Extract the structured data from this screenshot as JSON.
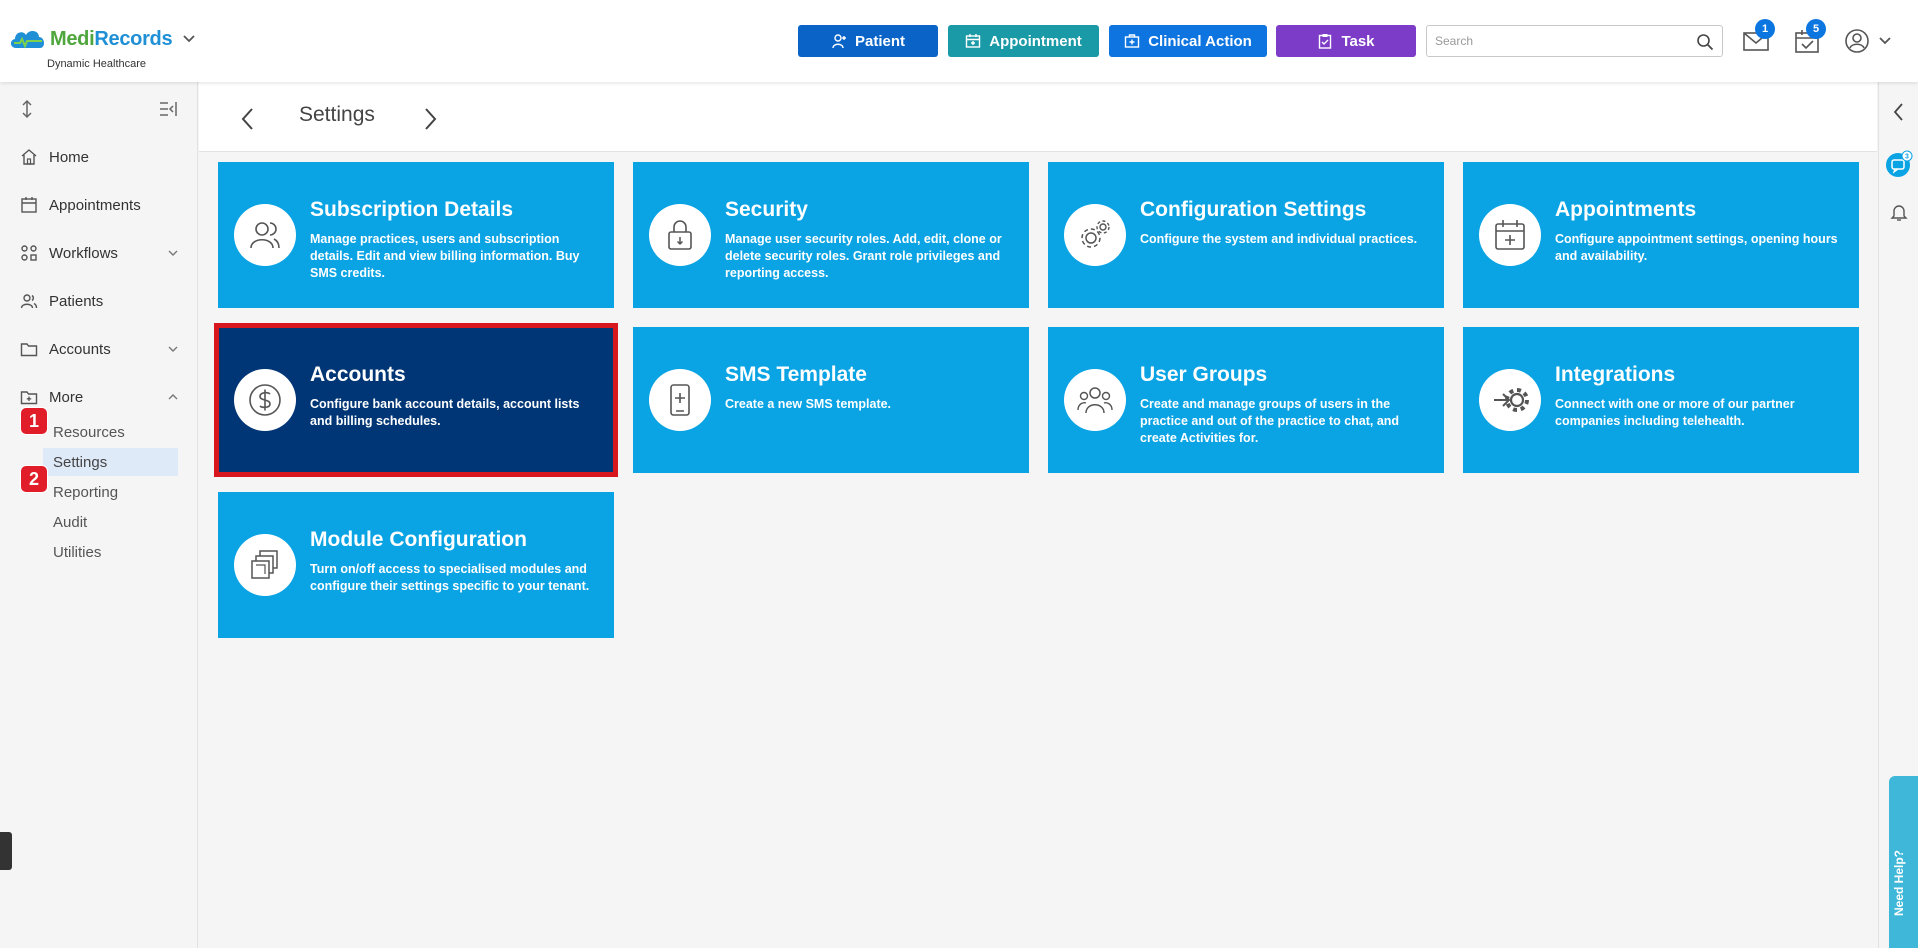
{
  "header": {
    "brand_medi": "Medi",
    "brand_records": "Records",
    "brand_subtitle": "Dynamic Healthcare",
    "buttons": {
      "patient": "Patient",
      "appointment": "Appointment",
      "clinical_action": "Clinical Action",
      "task": "Task"
    },
    "search_placeholder": "Search",
    "mail_badge": "1",
    "calendar_badge": "5"
  },
  "sidebar": {
    "items": [
      {
        "label": "Home"
      },
      {
        "label": "Appointments"
      },
      {
        "label": "Workflows"
      },
      {
        "label": "Patients"
      },
      {
        "label": "Accounts"
      },
      {
        "label": "More"
      }
    ],
    "more_subitems": [
      {
        "label": "Resources"
      },
      {
        "label": "Settings"
      },
      {
        "label": "Reporting"
      },
      {
        "label": "Audit"
      },
      {
        "label": "Utilities"
      }
    ],
    "active_subitem": "Settings",
    "step_markers": [
      "1",
      "2"
    ]
  },
  "page": {
    "title": "Settings"
  },
  "cards": [
    {
      "title": "Subscription Details",
      "desc": "Manage practices, users and subscription details. Edit and view billing information. Buy SMS credits.",
      "icon": "users-icon"
    },
    {
      "title": "Security",
      "desc": "Manage user security roles. Add, edit, clone or delete security roles. Grant role privileges and reporting access.",
      "icon": "lock-icon"
    },
    {
      "title": "Configuration Settings",
      "desc": "Configure the system and individual practices.",
      "icon": "gears-icon"
    },
    {
      "title": "Appointments",
      "desc": "Configure appointment settings, opening hours and availability.",
      "icon": "calendar-plus-icon"
    },
    {
      "title": "Accounts",
      "desc": "Configure bank account details, account lists and billing schedules.",
      "icon": "dollar-icon",
      "selected": true
    },
    {
      "title": "SMS Template",
      "desc": "Create a new SMS template.",
      "icon": "phone-plus-icon"
    },
    {
      "title": "User Groups",
      "desc": "Create and manage groups of users in the practice and out of the practice to chat, and create Activities for.",
      "icon": "user-group-icon"
    },
    {
      "title": "Integrations",
      "desc": "Connect with one or more of our partner companies including telehealth.",
      "icon": "integration-icon"
    },
    {
      "title": "Module Configuration",
      "desc": "Turn on/off access to specialised modules and configure their settings specific to your tenant.",
      "icon": "modules-icon"
    }
  ],
  "rail": {
    "chat_badge": "3",
    "need_help": "Need Help?"
  },
  "colors": {
    "card": "#0aa3e4",
    "card_selected": "#003675",
    "highlight_border": "#d8161e",
    "step_marker": "#e11d2a"
  }
}
